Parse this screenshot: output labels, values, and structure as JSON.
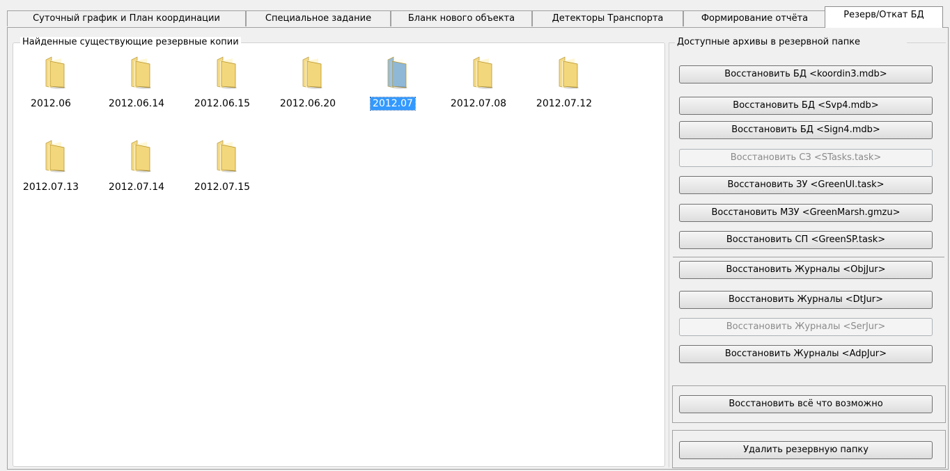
{
  "tabs": [
    {
      "label": "Суточный график и План координации",
      "active": false
    },
    {
      "label": "Специальное задание",
      "active": false
    },
    {
      "label": "Бланк нового объекта",
      "active": false
    },
    {
      "label": "Детекторы Транспорта",
      "active": false
    },
    {
      "label": "Формирование отчёта",
      "active": false
    },
    {
      "label": "Резерв/Откат БД",
      "active": true
    }
  ],
  "backups_group": {
    "title": "Найденные существующие резервные копии",
    "folders": [
      {
        "name": "2012.06",
        "selected": false
      },
      {
        "name": "2012.06.14",
        "selected": false
      },
      {
        "name": "2012.06.15",
        "selected": false
      },
      {
        "name": "2012.06.20",
        "selected": false
      },
      {
        "name": "2012.07",
        "selected": true
      },
      {
        "name": "2012.07.08",
        "selected": false
      },
      {
        "name": "2012.07.12",
        "selected": false
      },
      {
        "name": "2012.07.13",
        "selected": false
      },
      {
        "name": "2012.07.14",
        "selected": false
      },
      {
        "name": "2012.07.15",
        "selected": false
      }
    ]
  },
  "archives_group": {
    "title": "Доступные архивы в резервной папке",
    "buttons": [
      {
        "label": "Восстановить БД <koordin3.mdb>",
        "enabled": true
      },
      {
        "label": "Восстановить БД <Svp4.mdb>",
        "enabled": true
      },
      {
        "label": "Восстановить БД <Sign4.mdb>",
        "enabled": true
      },
      {
        "label": "Восстановить СЗ <STasks.task>",
        "enabled": false
      },
      {
        "label": "Восстановить ЗУ <GreenUI.task>",
        "enabled": true
      },
      {
        "label": "Восстановить МЗУ <GreenMarsh.gmzu>",
        "enabled": true
      },
      {
        "label": "Восстановить СП <GreenSP.task>",
        "enabled": true
      },
      {
        "label": "Восстановить Журналы <ObjJur>",
        "enabled": true
      },
      {
        "label": "Восстановить Журналы <DtJur>",
        "enabled": true
      },
      {
        "label": "Восстановить Журналы <SerJur>",
        "enabled": false
      },
      {
        "label": "Восстановить Журналы <AdpJur>",
        "enabled": true
      }
    ],
    "restore_all_label": "Восстановить всё что возможно",
    "delete_folder_label": "Удалить резервную папку"
  },
  "colors": {
    "selection": "#3399ff",
    "folder_yellow": "#f3d77c",
    "folder_selected_blue": "#8fb7d6"
  }
}
